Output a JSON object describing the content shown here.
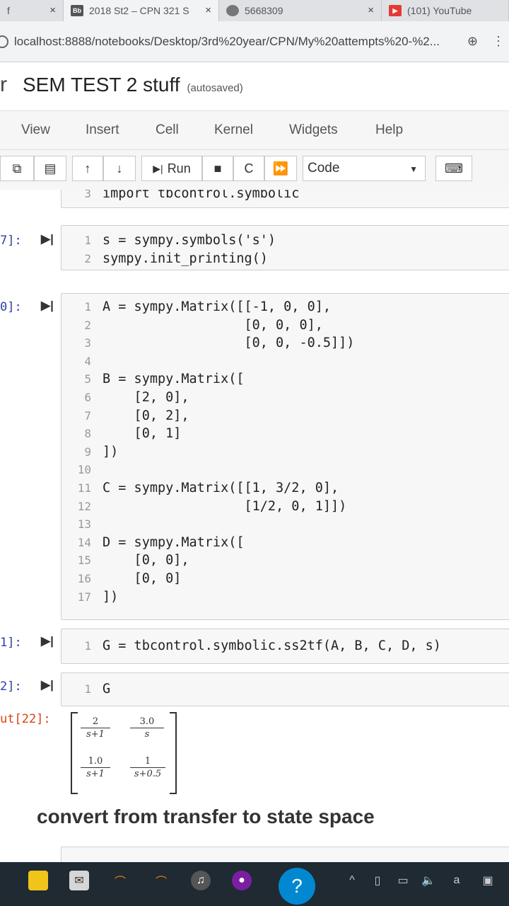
{
  "browser": {
    "tabs": [
      {
        "label": "f",
        "favicon": "",
        "close": "×"
      },
      {
        "label": "2018 St2 – CPN 321 S",
        "favicon": "Bb",
        "close": "×"
      },
      {
        "label": "5668309",
        "favicon": "",
        "close": "×"
      },
      {
        "label": "(101) YouTube",
        "favicon": "",
        "close": ""
      }
    ],
    "url": "localhost:8888/notebooks/Desktop/3rd%20year/CPN/My%20attempts%20-%2..."
  },
  "notebook": {
    "logo_fragment": "r",
    "title": "SEM TEST 2 stuff",
    "status": "(autosaved)"
  },
  "menu": [
    "View",
    "Insert",
    "Cell",
    "Kernel",
    "Widgets",
    "Help"
  ],
  "toolbar": {
    "run_label": "Run",
    "cell_type": "Code"
  },
  "cells": [
    {
      "prompt": "",
      "lines": [
        {
          "n": "3",
          "code": "import tbcontrol.symbolic"
        }
      ]
    },
    {
      "prompt": "7]:",
      "lines": [
        {
          "n": "1",
          "code": "s = sympy.symbols('s')"
        },
        {
          "n": "2",
          "code": "sympy.init_printing()"
        }
      ]
    },
    {
      "prompt": "0]:",
      "lines": [
        {
          "n": "1",
          "code": "A = sympy.Matrix([[-1, 0, 0],"
        },
        {
          "n": "2",
          "code": "                  [0, 0, 0],"
        },
        {
          "n": "3",
          "code": "                  [0, 0, -0.5]])"
        },
        {
          "n": "4",
          "code": ""
        },
        {
          "n": "5",
          "code": "B = sympy.Matrix(["
        },
        {
          "n": "6",
          "code": "    [2, 0],"
        },
        {
          "n": "7",
          "code": "    [0, 2],"
        },
        {
          "n": "8",
          "code": "    [0, 1]"
        },
        {
          "n": "9",
          "code": "])"
        },
        {
          "n": "10",
          "code": ""
        },
        {
          "n": "11",
          "code": "C = sympy.Matrix([[1, 3/2, 0],"
        },
        {
          "n": "12",
          "code": "                  [1/2, 0, 1]])"
        },
        {
          "n": "13",
          "code": ""
        },
        {
          "n": "14",
          "code": "D = sympy.Matrix(["
        },
        {
          "n": "15",
          "code": "    [0, 0],"
        },
        {
          "n": "16",
          "code": "    [0, 0]"
        },
        {
          "n": "17",
          "code": "])"
        }
      ]
    },
    {
      "prompt": "1]:",
      "lines": [
        {
          "n": "1",
          "code": "G = tbcontrol.symbolic.ss2tf(A, B, C, D, s)"
        }
      ]
    },
    {
      "prompt": "2]:",
      "lines": [
        {
          "n": "1",
          "code": "G"
        }
      ]
    }
  ],
  "output": {
    "prompt": "ut[22]:",
    "matrix": [
      [
        {
          "num": "2",
          "den": "s+1"
        },
        {
          "num": "3.0",
          "den": "s"
        }
      ],
      [
        {
          "num": "1.0",
          "den": "s+1"
        },
        {
          "num": "1",
          "den": "s+0.5"
        }
      ]
    ]
  },
  "markdown_heading": "convert from transfer to state space",
  "colors": {
    "prompt_in": "#303f9f",
    "prompt_out": "#d84315",
    "taskbar": "#1f2a33"
  }
}
